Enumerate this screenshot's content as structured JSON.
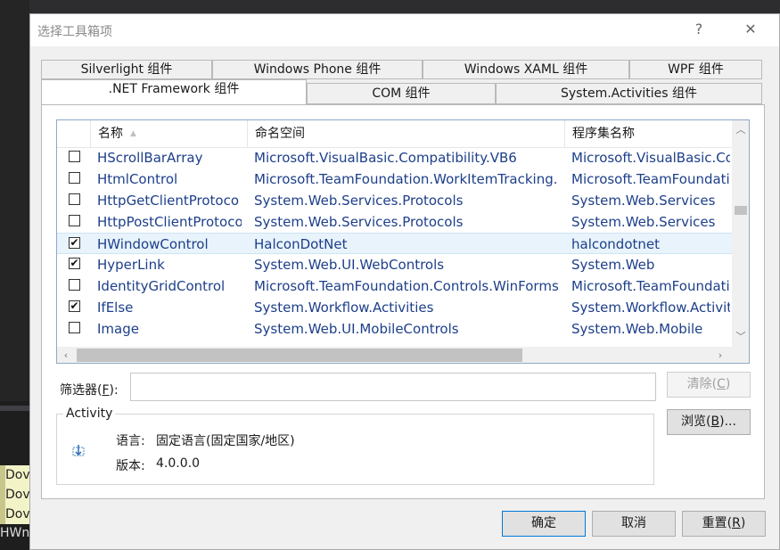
{
  "background": {
    "snippets": [
      "Dov",
      "Dov",
      "Dov"
    ],
    "hw_text": "HWn"
  },
  "dialog": {
    "title": "选择工具箱项",
    "help_label": "?",
    "close_label": "✕"
  },
  "tabs": {
    "row1": [
      "Silverlight 组件",
      "Windows Phone 组件",
      "Windows XAML 组件",
      "WPF 组件"
    ],
    "row2": [
      ".NET Framework 组件",
      "COM 组件",
      "System.Activities 组件"
    ],
    "active": ".NET Framework 组件"
  },
  "grid": {
    "headers": [
      "名称",
      "命名空间",
      "程序集名称"
    ],
    "sort_indicator": "▲",
    "rows": [
      {
        "checked": false,
        "name": "HScrollBarArray",
        "namespace": "Microsoft.VisualBasic.Compatibility.VB6",
        "assembly": "Microsoft.VisualBasic.Co"
      },
      {
        "checked": false,
        "name": "HtmlControl",
        "namespace": "Microsoft.TeamFoundation.WorkItemTracking.",
        "assembly": "Microsoft.TeamFoundati"
      },
      {
        "checked": false,
        "name": "HttpGetClientProtoco",
        "namespace": "System.Web.Services.Protocols",
        "assembly": "System.Web.Services"
      },
      {
        "checked": false,
        "name": "HttpPostClientProtoco",
        "namespace": "System.Web.Services.Protocols",
        "assembly": "System.Web.Services"
      },
      {
        "checked": true,
        "name": "HWindowControl",
        "namespace": "HalconDotNet",
        "assembly": "halcondotnet",
        "selected": true
      },
      {
        "checked": true,
        "name": "HyperLink",
        "namespace": "System.Web.UI.WebControls",
        "assembly": "System.Web"
      },
      {
        "checked": false,
        "name": "IdentityGridControl",
        "namespace": "Microsoft.TeamFoundation.Controls.WinForms",
        "assembly": "Microsoft.TeamFoundati"
      },
      {
        "checked": true,
        "name": "IfElse",
        "namespace": "System.Workflow.Activities",
        "assembly": "System.Workflow.Activit"
      },
      {
        "checked": false,
        "name": "Image",
        "namespace": "System.Web.UI.MobileControls",
        "assembly": "System.Web.Mobile"
      }
    ]
  },
  "filter": {
    "label": "筛选器(",
    "mnemonic": "F",
    "label_end": "):",
    "value": "",
    "placeholder": ""
  },
  "buttons": {
    "clear": {
      "label": "清除(",
      "mnemonic": "C",
      "end": ")"
    },
    "browse": {
      "label": "浏览(",
      "mnemonic": "B",
      "end": ")..."
    },
    "ok": "确定",
    "cancel": "取消",
    "reset": {
      "label": "重置(",
      "mnemonic": "R",
      "end": ")"
    }
  },
  "info": {
    "group_title": "Activity",
    "language_label": "语言:",
    "language_value": "固定语言(固定国家/地区)",
    "version_label": "版本:",
    "version_value": "4.0.0.0"
  },
  "colors": {
    "accent": "#0078d7",
    "link_text": "#1d3f8a",
    "selected_row": "#e8f3fb"
  }
}
